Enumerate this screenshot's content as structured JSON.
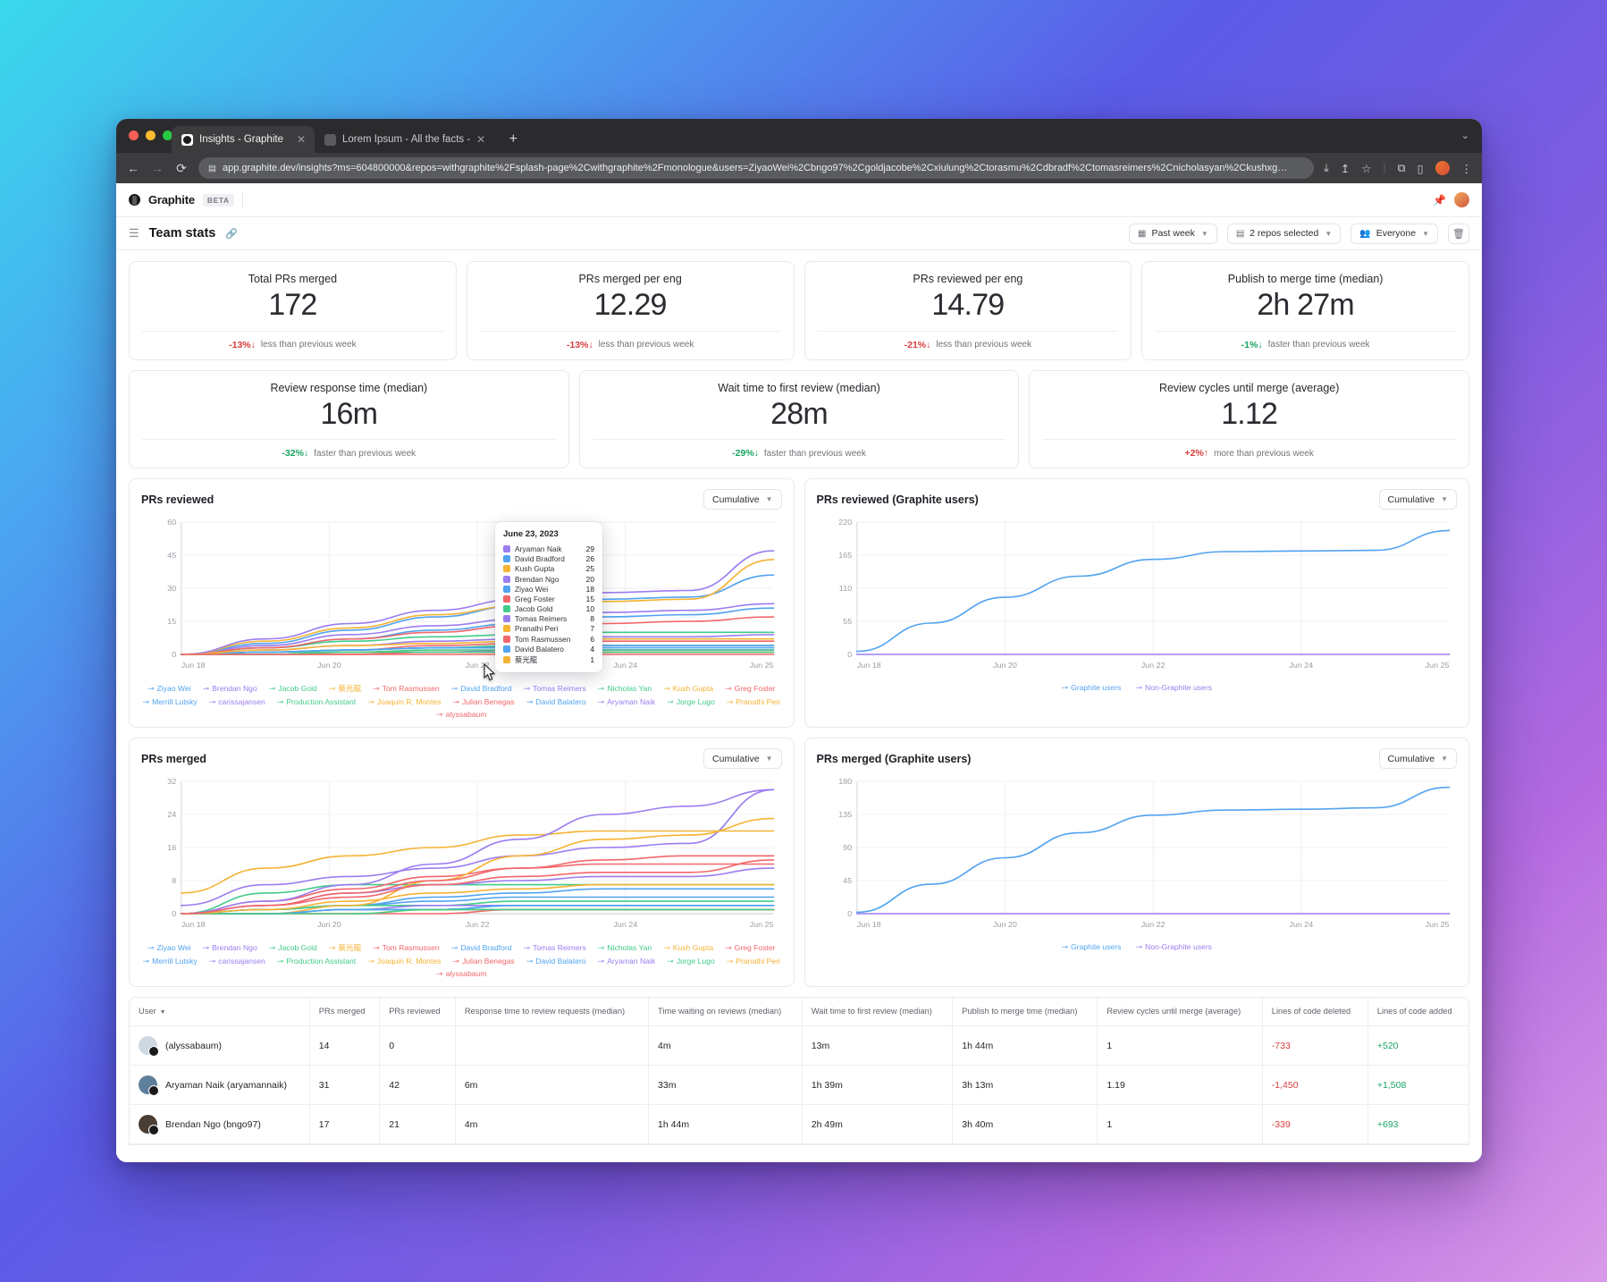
{
  "browser": {
    "tabs": [
      {
        "title": "Insights - Graphite",
        "active": true
      },
      {
        "title": "Lorem Ipsum - All the facts -",
        "active": false
      }
    ],
    "new_tab_label": "+",
    "url": "app.graphite.dev/insights?ms=604800000&repos=withgraphite%2Fsplash-page%2Cwithgraphite%2Fmonologue&users=ZiyaoWei%2Cbngo97%2Cgoldjacobe%2Cxiulung%2Ctorasmu%2Cdbradf%2Ctomasreimers%2Cnicholasyan%2Ckushxg…",
    "back_icon": "←",
    "forward_icon": "→",
    "reload_icon": "⟳",
    "close_icon": "✕"
  },
  "app": {
    "brand": "Graphite",
    "badge": "BETA",
    "page_title": "Team stats",
    "filters": [
      {
        "label": "Past week",
        "icon": "calendar-icon"
      },
      {
        "label": "2 repos selected",
        "icon": "list-icon"
      },
      {
        "label": "Everyone",
        "icon": "people-icon"
      }
    ],
    "delete_icon": "🗑"
  },
  "stats_row1": [
    {
      "label": "Total PRs merged",
      "value": "172",
      "delta": "-13%",
      "arrow": "↓",
      "tone": "neg",
      "note": "less than previous week"
    },
    {
      "label": "PRs merged per eng",
      "value": "12.29",
      "delta": "-13%",
      "arrow": "↓",
      "tone": "neg",
      "note": "less than previous week"
    },
    {
      "label": "PRs reviewed per eng",
      "value": "14.79",
      "delta": "-21%",
      "arrow": "↓",
      "tone": "neg",
      "note": "less than previous week"
    },
    {
      "label": "Publish to merge time (median)",
      "value": "2h 27m",
      "delta": "-1%",
      "arrow": "↓",
      "tone": "pos",
      "note": "faster than previous week"
    }
  ],
  "stats_row2": [
    {
      "label": "Review response time (median)",
      "value": "16m",
      "delta": "-32%",
      "arrow": "↓",
      "tone": "pos",
      "note": "faster than previous week"
    },
    {
      "label": "Wait time to first review (median)",
      "value": "28m",
      "delta": "-29%",
      "arrow": "↓",
      "tone": "pos",
      "note": "faster than previous week"
    },
    {
      "label": "Review cycles until merge (average)",
      "value": "1.12",
      "delta": "+2%",
      "arrow": "↑",
      "tone": "up",
      "note": "more than previous week"
    }
  ],
  "tooltip": {
    "date": "June 23, 2023",
    "rows": [
      {
        "name": "Aryaman Naik",
        "value": "29",
        "color": "#9b7df0"
      },
      {
        "name": "David Bradford",
        "value": "26",
        "color": "#52a3f0"
      },
      {
        "name": "Kush Gupta",
        "value": "25",
        "color": "#f5b335"
      },
      {
        "name": "Brendan Ngo",
        "value": "20",
        "color": "#9b7df0"
      },
      {
        "name": "Ziyao Wei",
        "value": "18",
        "color": "#52a3f0"
      },
      {
        "name": "Greg Foster",
        "value": "15",
        "color": "#f2676b"
      },
      {
        "name": "Jacob Gold",
        "value": "10",
        "color": "#43cb8a"
      },
      {
        "name": "Tomas Reimers",
        "value": "8",
        "color": "#9b7df0"
      },
      {
        "name": "Pranathi Peri",
        "value": "7",
        "color": "#f5b335"
      },
      {
        "name": "Tom Rasmussen",
        "value": "6",
        "color": "#f2676b"
      },
      {
        "name": "David Balatero",
        "value": "4",
        "color": "#52a3f0"
      },
      {
        "name": "蔡光龍",
        "value": "1",
        "color": "#f5b335"
      }
    ]
  },
  "chart_data": [
    {
      "id": "prs-reviewed",
      "type": "line",
      "title": "PRs reviewed",
      "mode_label": "Cumulative",
      "xlabel": "",
      "ylabel": "",
      "ylim": [
        0,
        60
      ],
      "yticks": [
        "0",
        "15",
        "30",
        "45",
        "60"
      ],
      "xticks": [
        "Jun 18",
        "Jun 20",
        "Jun 22",
        "Jun 24",
        "Jun 25"
      ],
      "grid": true,
      "legend_position": "bottom",
      "series": [
        {
          "name": "Ziyao Wei",
          "color": "#52a3f0",
          "values": [
            0,
            3,
            7,
            11,
            14,
            17,
            18,
            21
          ]
        },
        {
          "name": "Brendan Ngo",
          "color": "#9b7df0",
          "values": [
            0,
            4,
            9,
            13,
            16,
            19,
            20,
            23
          ]
        },
        {
          "name": "Jacob Gold",
          "color": "#43cb8a",
          "values": [
            0,
            3,
            6,
            8,
            9,
            10,
            10,
            10
          ]
        },
        {
          "name": "蔡光龍",
          "color": "#f5b335",
          "values": [
            0,
            0,
            0,
            1,
            1,
            1,
            1,
            1
          ]
        },
        {
          "name": "Tom Rasmussen",
          "color": "#f2676b",
          "values": [
            0,
            1,
            2,
            4,
            5,
            6,
            6,
            6
          ]
        },
        {
          "name": "David Bradford",
          "color": "#52a3f0",
          "values": [
            0,
            5,
            11,
            17,
            22,
            25,
            26,
            36
          ]
        },
        {
          "name": "Tomas Reimers",
          "color": "#9b7df0",
          "values": [
            0,
            2,
            4,
            6,
            7,
            8,
            8,
            9
          ]
        },
        {
          "name": "Nicholas Yan",
          "color": "#43cb8a",
          "values": [
            0,
            1,
            2,
            3,
            4,
            4,
            4,
            4
          ]
        },
        {
          "name": "Kush Gupta",
          "color": "#f5b335",
          "values": [
            0,
            6,
            12,
            18,
            22,
            24,
            25,
            43
          ]
        },
        {
          "name": "Greg Foster",
          "color": "#f2676b",
          "values": [
            0,
            3,
            7,
            10,
            13,
            14,
            15,
            17
          ]
        },
        {
          "name": "Merrill Lutsky",
          "color": "#52a3f0",
          "values": [
            0,
            1,
            2,
            3,
            3,
            3,
            3,
            3
          ]
        },
        {
          "name": "carissajansen",
          "color": "#9b7df0",
          "values": [
            0,
            0,
            1,
            1,
            2,
            2,
            2,
            2
          ]
        },
        {
          "name": "Production Assistant",
          "color": "#43cb8a",
          "values": [
            0,
            1,
            1,
            2,
            2,
            2,
            2,
            2
          ]
        },
        {
          "name": "Joaquin R. Montes",
          "color": "#f5b335",
          "values": [
            0,
            0,
            1,
            1,
            1,
            1,
            1,
            1
          ]
        },
        {
          "name": "Julian Benegas",
          "color": "#f2676b",
          "values": [
            0,
            0,
            0,
            1,
            1,
            1,
            1,
            1
          ]
        },
        {
          "name": "David Balatero",
          "color": "#52a3f0",
          "values": [
            0,
            1,
            2,
            3,
            3,
            4,
            4,
            4
          ]
        },
        {
          "name": "Aryaman Naik",
          "color": "#9b7df0",
          "values": [
            0,
            7,
            14,
            20,
            25,
            28,
            29,
            47
          ]
        },
        {
          "name": "Jorge Lugo",
          "color": "#43cb8a",
          "values": [
            0,
            0,
            1,
            1,
            1,
            1,
            1,
            1
          ]
        },
        {
          "name": "Pranathi Peri",
          "color": "#f5b335",
          "values": [
            0,
            2,
            4,
            5,
            6,
            7,
            7,
            7
          ]
        },
        {
          "name": "alyssabaum",
          "color": "#f2676b",
          "values": [
            0,
            0,
            0,
            0,
            0,
            0,
            0,
            0
          ]
        }
      ]
    },
    {
      "id": "prs-reviewed-graphite-users",
      "type": "line",
      "title": "PRs reviewed (Graphite users)",
      "mode_label": "Cumulative",
      "ylim": [
        0,
        220
      ],
      "yticks": [
        "0",
        "55",
        "110",
        "165",
        "220"
      ],
      "xticks": [
        "Jun 18",
        "Jun 20",
        "Jun 22",
        "Jun 24",
        "Jun 25"
      ],
      "grid": true,
      "legend_position": "bottom",
      "series": [
        {
          "name": "Graphite users",
          "color": "#52a3f0",
          "values": [
            5,
            52,
            95,
            130,
            158,
            171,
            172,
            173,
            206
          ]
        },
        {
          "name": "Non-Graphite users",
          "color": "#9b7df0",
          "values": [
            0,
            0,
            0,
            0,
            0,
            0,
            0,
            0,
            0
          ]
        }
      ]
    },
    {
      "id": "prs-merged",
      "type": "line",
      "title": "PRs merged",
      "mode_label": "Cumulative",
      "ylim": [
        0,
        32
      ],
      "yticks": [
        "0",
        "8",
        "16",
        "24",
        "32"
      ],
      "xticks": [
        "Jun 18",
        "Jun 20",
        "Jun 22",
        "Jun 24",
        "Jun 25"
      ],
      "grid": true,
      "legend_position": "bottom",
      "series": [
        {
          "name": "Ziyao Wei",
          "color": "#52a3f0",
          "values": [
            0,
            1,
            2,
            4,
            5,
            6,
            6,
            6
          ]
        },
        {
          "name": "Brendan Ngo",
          "color": "#9b7df0",
          "values": [
            2,
            7,
            9,
            11,
            14,
            16,
            17,
            30
          ]
        },
        {
          "name": "Jacob Gold",
          "color": "#43cb8a",
          "values": [
            0,
            5,
            7,
            7,
            7,
            7,
            7,
            7
          ]
        },
        {
          "name": "蔡光龍",
          "color": "#f5b335",
          "values": [
            5,
            11,
            14,
            16,
            19,
            20,
            20,
            20
          ]
        },
        {
          "name": "Tom Rasmussen",
          "color": "#f2676b",
          "values": [
            0,
            3,
            6,
            9,
            11,
            12,
            12,
            12
          ]
        },
        {
          "name": "David Bradford",
          "color": "#52a3f0",
          "values": [
            0,
            1,
            2,
            3,
            4,
            4,
            4,
            4
          ]
        },
        {
          "name": "Tomas Reimers",
          "color": "#9b7df0",
          "values": [
            0,
            2,
            5,
            7,
            8,
            9,
            9,
            11
          ]
        },
        {
          "name": "Nicholas Yan",
          "color": "#43cb8a",
          "values": [
            0,
            1,
            2,
            2,
            3,
            3,
            3,
            3
          ]
        },
        {
          "name": "Kush Gupta",
          "color": "#f5b335",
          "values": [
            0,
            0,
            2,
            8,
            14,
            18,
            19,
            23
          ]
        },
        {
          "name": "Greg Foster",
          "color": "#f2676b",
          "values": [
            0,
            2,
            4,
            7,
            9,
            10,
            10,
            13
          ]
        },
        {
          "name": "Merrill Lutsky",
          "color": "#52a3f0",
          "values": [
            0,
            0,
            1,
            1,
            2,
            2,
            2,
            2
          ]
        },
        {
          "name": "carissajansen",
          "color": "#9b7df0",
          "values": [
            0,
            0,
            1,
            2,
            2,
            2,
            2,
            2
          ]
        },
        {
          "name": "Production Assistant",
          "color": "#43cb8a",
          "values": [
            0,
            0,
            1,
            1,
            1,
            1,
            1,
            1
          ]
        },
        {
          "name": "Joaquin R. Montes",
          "color": "#f5b335",
          "values": [
            0,
            0,
            0,
            1,
            1,
            1,
            1,
            1
          ]
        },
        {
          "name": "Julian Benegas",
          "color": "#f2676b",
          "values": [
            0,
            0,
            0,
            0,
            1,
            1,
            1,
            1
          ]
        },
        {
          "name": "David Balatero",
          "color": "#52a3f0",
          "values": [
            0,
            0,
            1,
            1,
            2,
            2,
            2,
            2
          ]
        },
        {
          "name": "Aryaman Naik",
          "color": "#9b7df0",
          "values": [
            0,
            3,
            7,
            12,
            18,
            24,
            26,
            30
          ]
        },
        {
          "name": "Jorge Lugo",
          "color": "#43cb8a",
          "values": [
            0,
            0,
            0,
            1,
            1,
            1,
            1,
            1
          ]
        },
        {
          "name": "Pranathi Peri",
          "color": "#f5b335",
          "values": [
            0,
            1,
            3,
            5,
            6,
            7,
            7,
            7
          ]
        },
        {
          "name": "alyssabaum",
          "color": "#f2676b",
          "values": [
            0,
            2,
            5,
            8,
            11,
            13,
            14,
            14
          ]
        }
      ]
    },
    {
      "id": "prs-merged-graphite-users",
      "type": "line",
      "title": "PRs merged (Graphite users)",
      "mode_label": "Cumulative",
      "ylim": [
        0,
        180
      ],
      "yticks": [
        "0",
        "45",
        "90",
        "135",
        "180"
      ],
      "xticks": [
        "Jun 18",
        "Jun 20",
        "Jun 22",
        "Jun 24",
        "Jun 25"
      ],
      "grid": true,
      "legend_position": "bottom",
      "series": [
        {
          "name": "Graphite users",
          "color": "#52a3f0",
          "values": [
            2,
            40,
            76,
            110,
            134,
            141,
            142,
            144,
            172
          ]
        },
        {
          "name": "Non-Graphite users",
          "color": "#9b7df0",
          "values": [
            0,
            0,
            0,
            0,
            0,
            0,
            0,
            0,
            0
          ]
        }
      ]
    }
  ],
  "table": {
    "columns": [
      "User",
      "PRs merged",
      "PRs reviewed",
      "Response time to review requests (median)",
      "Time waiting on reviews (median)",
      "Wait time to first review (median)",
      "Publish to merge time (median)",
      "Review cycles until merge (average)",
      "Lines of code deleted",
      "Lines of code added"
    ],
    "sort_icon": "▼",
    "rows": [
      {
        "user": "(alyssabaum)",
        "avatar_color": "#cdd8e2",
        "prs_merged": "14",
        "prs_reviewed": "0",
        "response_time": "",
        "time_waiting": "4m",
        "wait_first_review": "13m",
        "publish_to_merge": "1h 44m",
        "review_cycles": "1",
        "loc_deleted": "-733",
        "loc_added": "+520"
      },
      {
        "user": "Aryaman Naik (aryamannaik)",
        "avatar_color": "#5d7f9c",
        "prs_merged": "31",
        "prs_reviewed": "42",
        "response_time": "6m",
        "time_waiting": "33m",
        "wait_first_review": "1h 39m",
        "publish_to_merge": "3h 13m",
        "review_cycles": "1.19",
        "loc_deleted": "-1,450",
        "loc_added": "+1,508"
      },
      {
        "user": "Brendan Ngo (bngo97)",
        "avatar_color": "#4a3d34",
        "prs_merged": "17",
        "prs_reviewed": "21",
        "response_time": "4m",
        "time_waiting": "1h 44m",
        "wait_first_review": "2h 49m",
        "publish_to_merge": "3h 40m",
        "review_cycles": "1",
        "loc_deleted": "-339",
        "loc_added": "+693"
      }
    ]
  }
}
